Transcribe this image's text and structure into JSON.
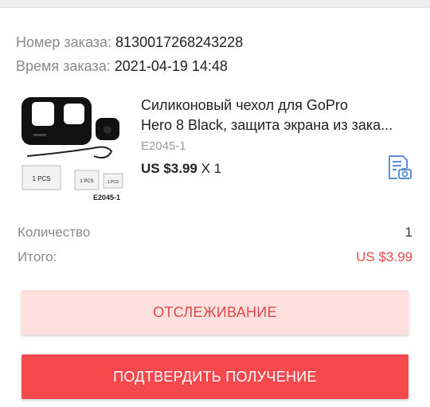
{
  "order": {
    "number_label": "Номер заказа:",
    "number_value": "8130017268243228",
    "time_label": "Время заказа:",
    "time_value": "2021-04-19 14:48"
  },
  "product": {
    "title_line1": "Силиконовый чехол для GoPro",
    "title_line2": "Hero 8 Black, защита экрана из зака...",
    "sku": "E2045-1",
    "price": "US $3.99",
    "quantity_suffix": "X 1",
    "image_labels": {
      "film_big": "1 PCS",
      "film_mid": "1 PCS",
      "film_small": "1 PCS",
      "sku": "E2045-1"
    },
    "snapshot_icon": "order-snapshot-icon"
  },
  "summary": {
    "quantity_label": "Количество",
    "quantity_value": "1",
    "total_label": "Итого:",
    "total_value": "US $3.99"
  },
  "buttons": {
    "track_label": "ОТСЛЕЖИВАНИЕ",
    "confirm_label": "ПОДТВЕРДИТЬ ПОЛУЧЕНИЕ"
  },
  "colors": {
    "accent_red": "#e64c4c",
    "track_bg": "#fde0de",
    "confirm_bg": "#f5494d",
    "icon_blue": "#5b8fd6"
  }
}
